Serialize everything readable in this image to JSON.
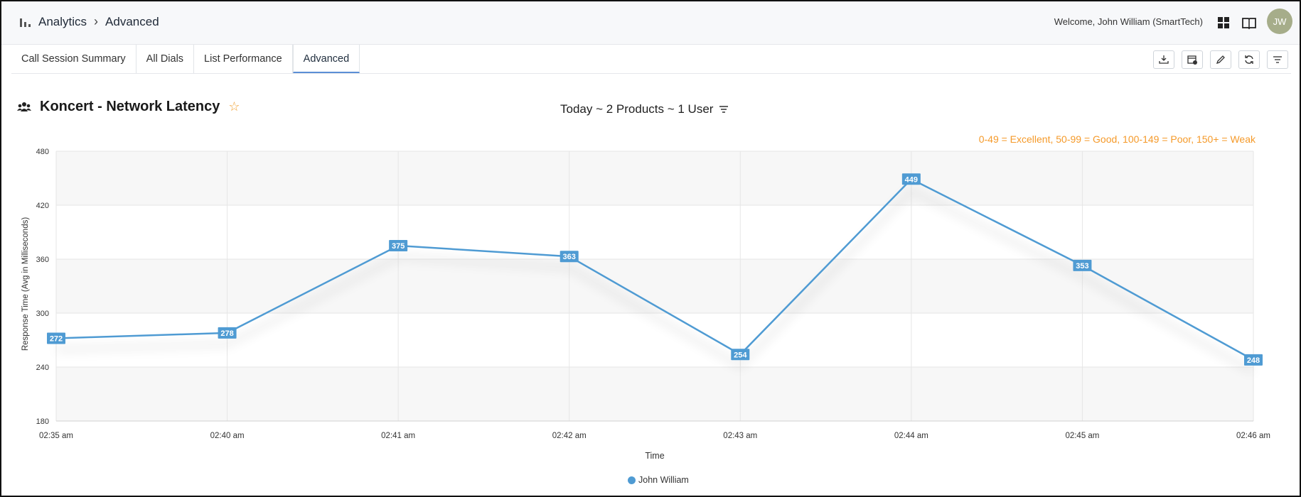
{
  "breadcrumb": {
    "root": "Analytics",
    "current": "Advanced"
  },
  "header": {
    "welcome": "Welcome, John William (SmartTech)",
    "avatar_initials": "JW"
  },
  "tabs": [
    {
      "label": "Call Session Summary",
      "active": false
    },
    {
      "label": "All Dials",
      "active": false
    },
    {
      "label": "List Performance",
      "active": false
    },
    {
      "label": "Advanced",
      "active": true
    }
  ],
  "toolbar": {
    "icons": [
      "download-icon",
      "calendar-icon",
      "edit-icon",
      "refresh-icon",
      "filter-icon"
    ]
  },
  "chart_header": {
    "title": "Koncert - Network Latency",
    "filter_summary": "Today ~ 2 Products ~ 1 User",
    "scale_note": "0-49 = Excellent,  50-99 = Good,  100-149 = Poor,  150+ = Weak"
  },
  "colors": {
    "series": "#4f9bd3",
    "accent": "#5b8fd6",
    "note": "#f59a2a",
    "star": "#f0a030"
  },
  "chart_data": {
    "type": "line",
    "x": [
      "02:35 am",
      "02:40 am",
      "02:41 am",
      "02:42 am",
      "02:43 am",
      "02:44 am",
      "02:45 am",
      "02:46 am"
    ],
    "series": [
      {
        "name": "John William",
        "values": [
          272,
          278,
          375,
          363,
          254,
          449,
          353,
          248
        ]
      }
    ],
    "xlabel": "Time",
    "ylabel": "Response Time (Avg in Milliseconds)",
    "ylim": [
      180,
      480
    ],
    "yticks": [
      180,
      240,
      300,
      360,
      420,
      480
    ],
    "data_labels": true,
    "grid": true,
    "legend": "bottom-center"
  }
}
